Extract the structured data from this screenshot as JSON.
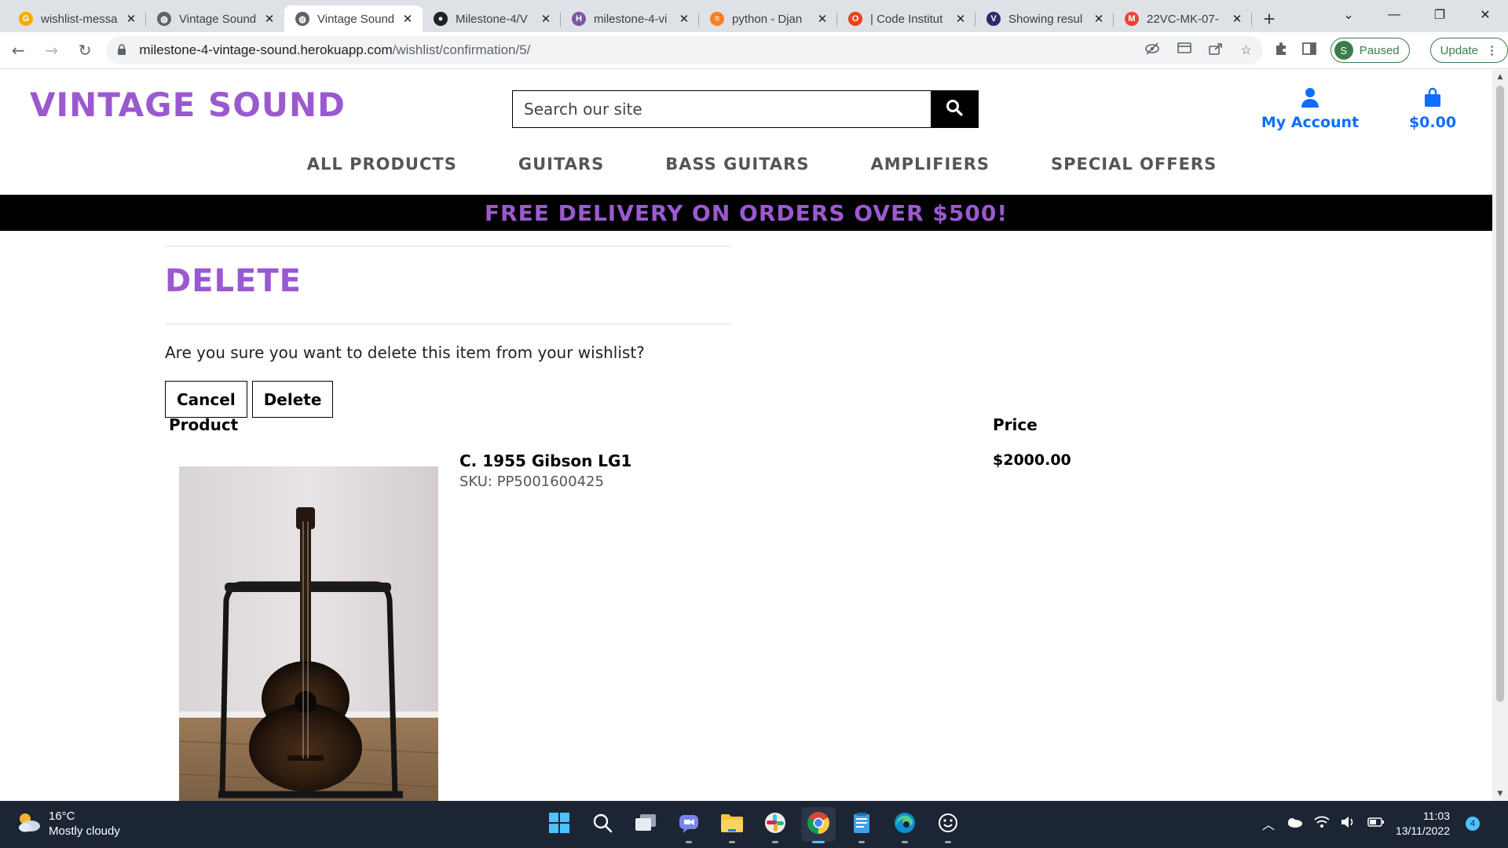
{
  "browser": {
    "tabs": [
      {
        "title": "wishlist-messa",
        "icon": "g-logo-icon",
        "color": "#f9ab00",
        "active": false
      },
      {
        "title": "Vintage Sound",
        "icon": "globe-icon",
        "color": "#5f6368",
        "active": false
      },
      {
        "title": "Vintage Sound",
        "icon": "globe-icon",
        "color": "#5f6368",
        "active": true
      },
      {
        "title": "Milestone-4/V",
        "icon": "github-icon",
        "color": "#202124",
        "active": false
      },
      {
        "title": "milestone-4-vi",
        "icon": "heroku-icon",
        "color": "#79589f",
        "active": false
      },
      {
        "title": "python - Djan",
        "icon": "stackoverflow-icon",
        "color": "#f48024",
        "active": false
      },
      {
        "title": "| Code Institut",
        "icon": "code-institute-icon",
        "color": "#e8421a",
        "active": false
      },
      {
        "title": "Showing resul",
        "icon": "search-result-icon",
        "color": "#2b2b6b",
        "active": false
      },
      {
        "title": "22VC-MK-07-",
        "icon": "gmail-icon",
        "color": "#ea4335",
        "active": false
      }
    ],
    "url_host": "milestone-4-vintage-sound.herokuapp.com",
    "url_path": "/wishlist/confirmation/5/",
    "profile_initial": "S",
    "profile_status": "Paused",
    "update_label": "Update"
  },
  "site": {
    "brand": "VINTAGE SOUND",
    "search_placeholder": "Search our site",
    "account_label": "My Account",
    "basket_total": "$0.00",
    "nav": [
      "ALL PRODUCTS",
      "GUITARS",
      "BASS GUITARS",
      "AMPLIFIERS",
      "SPECIAL OFFERS"
    ],
    "banner": "FREE DELIVERY ON ORDERS OVER $500!",
    "brand_color": "#9b59d0",
    "link_color": "#0d6efd"
  },
  "page": {
    "title": "DELETE",
    "question": "Are you sure you want to delete this item from your wishlist?",
    "cancel_label": "Cancel",
    "delete_label": "Delete",
    "col_product": "Product",
    "col_price": "Price",
    "product_name": "C. 1955 Gibson LG1",
    "product_sku": "SKU: PP5001600425",
    "product_price": "$2000.00"
  },
  "taskbar": {
    "temperature": "16°C",
    "weather": "Mostly cloudy",
    "time": "11:03",
    "date": "13/11/2022",
    "notifications": "4"
  }
}
